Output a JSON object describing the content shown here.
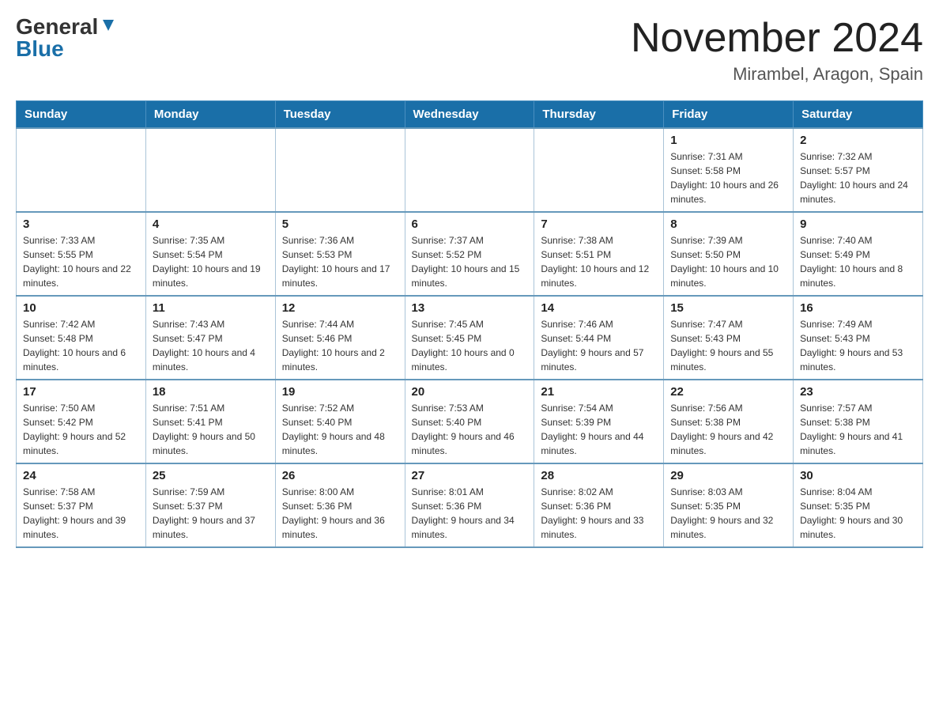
{
  "header": {
    "logo_general": "General",
    "logo_blue": "Blue",
    "title": "November 2024",
    "location": "Mirambel, Aragon, Spain"
  },
  "days_of_week": [
    "Sunday",
    "Monday",
    "Tuesday",
    "Wednesday",
    "Thursday",
    "Friday",
    "Saturday"
  ],
  "weeks": [
    [
      {
        "day": "",
        "info": ""
      },
      {
        "day": "",
        "info": ""
      },
      {
        "day": "",
        "info": ""
      },
      {
        "day": "",
        "info": ""
      },
      {
        "day": "",
        "info": ""
      },
      {
        "day": "1",
        "info": "Sunrise: 7:31 AM\nSunset: 5:58 PM\nDaylight: 10 hours and 26 minutes."
      },
      {
        "day": "2",
        "info": "Sunrise: 7:32 AM\nSunset: 5:57 PM\nDaylight: 10 hours and 24 minutes."
      }
    ],
    [
      {
        "day": "3",
        "info": "Sunrise: 7:33 AM\nSunset: 5:55 PM\nDaylight: 10 hours and 22 minutes."
      },
      {
        "day": "4",
        "info": "Sunrise: 7:35 AM\nSunset: 5:54 PM\nDaylight: 10 hours and 19 minutes."
      },
      {
        "day": "5",
        "info": "Sunrise: 7:36 AM\nSunset: 5:53 PM\nDaylight: 10 hours and 17 minutes."
      },
      {
        "day": "6",
        "info": "Sunrise: 7:37 AM\nSunset: 5:52 PM\nDaylight: 10 hours and 15 minutes."
      },
      {
        "day": "7",
        "info": "Sunrise: 7:38 AM\nSunset: 5:51 PM\nDaylight: 10 hours and 12 minutes."
      },
      {
        "day": "8",
        "info": "Sunrise: 7:39 AM\nSunset: 5:50 PM\nDaylight: 10 hours and 10 minutes."
      },
      {
        "day": "9",
        "info": "Sunrise: 7:40 AM\nSunset: 5:49 PM\nDaylight: 10 hours and 8 minutes."
      }
    ],
    [
      {
        "day": "10",
        "info": "Sunrise: 7:42 AM\nSunset: 5:48 PM\nDaylight: 10 hours and 6 minutes."
      },
      {
        "day": "11",
        "info": "Sunrise: 7:43 AM\nSunset: 5:47 PM\nDaylight: 10 hours and 4 minutes."
      },
      {
        "day": "12",
        "info": "Sunrise: 7:44 AM\nSunset: 5:46 PM\nDaylight: 10 hours and 2 minutes."
      },
      {
        "day": "13",
        "info": "Sunrise: 7:45 AM\nSunset: 5:45 PM\nDaylight: 10 hours and 0 minutes."
      },
      {
        "day": "14",
        "info": "Sunrise: 7:46 AM\nSunset: 5:44 PM\nDaylight: 9 hours and 57 minutes."
      },
      {
        "day": "15",
        "info": "Sunrise: 7:47 AM\nSunset: 5:43 PM\nDaylight: 9 hours and 55 minutes."
      },
      {
        "day": "16",
        "info": "Sunrise: 7:49 AM\nSunset: 5:43 PM\nDaylight: 9 hours and 53 minutes."
      }
    ],
    [
      {
        "day": "17",
        "info": "Sunrise: 7:50 AM\nSunset: 5:42 PM\nDaylight: 9 hours and 52 minutes."
      },
      {
        "day": "18",
        "info": "Sunrise: 7:51 AM\nSunset: 5:41 PM\nDaylight: 9 hours and 50 minutes."
      },
      {
        "day": "19",
        "info": "Sunrise: 7:52 AM\nSunset: 5:40 PM\nDaylight: 9 hours and 48 minutes."
      },
      {
        "day": "20",
        "info": "Sunrise: 7:53 AM\nSunset: 5:40 PM\nDaylight: 9 hours and 46 minutes."
      },
      {
        "day": "21",
        "info": "Sunrise: 7:54 AM\nSunset: 5:39 PM\nDaylight: 9 hours and 44 minutes."
      },
      {
        "day": "22",
        "info": "Sunrise: 7:56 AM\nSunset: 5:38 PM\nDaylight: 9 hours and 42 minutes."
      },
      {
        "day": "23",
        "info": "Sunrise: 7:57 AM\nSunset: 5:38 PM\nDaylight: 9 hours and 41 minutes."
      }
    ],
    [
      {
        "day": "24",
        "info": "Sunrise: 7:58 AM\nSunset: 5:37 PM\nDaylight: 9 hours and 39 minutes."
      },
      {
        "day": "25",
        "info": "Sunrise: 7:59 AM\nSunset: 5:37 PM\nDaylight: 9 hours and 37 minutes."
      },
      {
        "day": "26",
        "info": "Sunrise: 8:00 AM\nSunset: 5:36 PM\nDaylight: 9 hours and 36 minutes."
      },
      {
        "day": "27",
        "info": "Sunrise: 8:01 AM\nSunset: 5:36 PM\nDaylight: 9 hours and 34 minutes."
      },
      {
        "day": "28",
        "info": "Sunrise: 8:02 AM\nSunset: 5:36 PM\nDaylight: 9 hours and 33 minutes."
      },
      {
        "day": "29",
        "info": "Sunrise: 8:03 AM\nSunset: 5:35 PM\nDaylight: 9 hours and 32 minutes."
      },
      {
        "day": "30",
        "info": "Sunrise: 8:04 AM\nSunset: 5:35 PM\nDaylight: 9 hours and 30 minutes."
      }
    ]
  ]
}
